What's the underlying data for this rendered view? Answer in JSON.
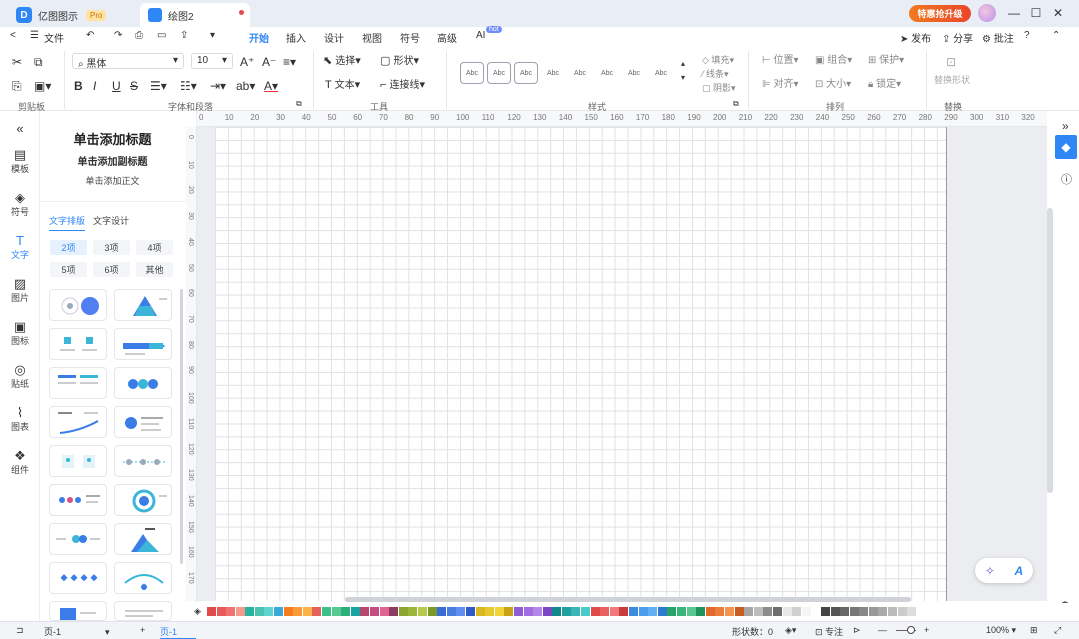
{
  "titlebar": {
    "app_tab": "亿图图示",
    "pro_badge": "Pro",
    "doc_tab": "绘图2",
    "upgrade": "特惠抢升级",
    "win_min": "—",
    "win_max": "☐",
    "win_close": "✕"
  },
  "menubar": {
    "back": "<",
    "file": "文件",
    "undo": "↶",
    "redo": "↷",
    "items": [
      "开始",
      "插入",
      "设计",
      "视图",
      "符号",
      "高级",
      "AI"
    ],
    "hot": "hot",
    "publish": "发布",
    "share": "分享",
    "comment": "批注",
    "help": "?"
  },
  "ribbon": {
    "font_family": "黑体",
    "font_size": "10",
    "select": "选择",
    "shape": "形状",
    "text": "文本",
    "connector": "连接线",
    "fill": "填充",
    "line": "线条",
    "shadow": "阴影",
    "position": "位置",
    "group": "组合",
    "protect": "保护",
    "align": "对齐",
    "size": "大小",
    "lock": "锁定",
    "replace": "替换形状",
    "style_label": "Abc",
    "groups": {
      "clipboard": "剪贴板",
      "font": "字体和段落",
      "tools": "工具",
      "styles": "样式",
      "arrange": "排列",
      "replace": "替换"
    }
  },
  "leftbar": {
    "items": [
      {
        "icon": "«",
        "label": ""
      },
      {
        "icon": "▤",
        "label": "模板"
      },
      {
        "icon": "◈",
        "label": "符号"
      },
      {
        "icon": "T",
        "label": "文字"
      },
      {
        "icon": "▨",
        "label": "图片"
      },
      {
        "icon": "▣",
        "label": "图标"
      },
      {
        "icon": "◎",
        "label": "贴纸"
      },
      {
        "icon": "⌇",
        "label": "图表"
      },
      {
        "icon": "❖",
        "label": "组件"
      }
    ]
  },
  "panel": {
    "title": "单击添加标题",
    "subtitle": "单击添加副标题",
    "body": "单击添加正文",
    "tabs": [
      "文字排版",
      "文字设计"
    ],
    "chips": [
      "2项",
      "3项",
      "4项",
      "5项",
      "6项",
      "其他"
    ]
  },
  "ruler": {
    "top": [
      "0",
      "10",
      "20",
      "30",
      "40",
      "50",
      "60",
      "70",
      "80",
      "90",
      "100",
      "110",
      "120",
      "130",
      "140",
      "150",
      "160",
      "170",
      "180",
      "190",
      "200",
      "210",
      "220",
      "230",
      "240",
      "250",
      "260",
      "270",
      "280",
      "290",
      "300",
      "310",
      "320"
    ],
    "left": [
      "0",
      "10",
      "20",
      "30",
      "40",
      "50",
      "60",
      "70",
      "80",
      "90",
      "100",
      "110",
      "120",
      "130",
      "140",
      "150",
      "160",
      "170"
    ]
  },
  "colors": [
    "#e24a4a",
    "#e85a5a",
    "#f07272",
    "#f39a8a",
    "#26b49f",
    "#4bc3b2",
    "#5fd3d0",
    "#3aa8d8",
    "#f57c1f",
    "#f89a3a",
    "#fbb24a",
    "#e2625a",
    "#3cbf8a",
    "#56c98f",
    "#2bb07c",
    "#19a3a3",
    "#b6466e",
    "#c24d7e",
    "#e06491",
    "#8e3b62",
    "#8aa531",
    "#9ab53c",
    "#b5c94a",
    "#7c9a2a",
    "#3b6bd6",
    "#4a7de0",
    "#5f8ff0",
    "#2f5cc4",
    "#d9b823",
    "#e6c830",
    "#f0d43a",
    "#c9a218",
    "#8e5cd6",
    "#a06ee2",
    "#b488ea",
    "#7a48c4",
    "#0f8a8a",
    "#22a0a0",
    "#3bb5b5",
    "#4acaca",
    "#e04a4a",
    "#ea6060",
    "#f07a7a",
    "#c93a3a",
    "#3c8bdc",
    "#4a9cec",
    "#62aef2",
    "#2c7bcc",
    "#2aa36a",
    "#3ab57a",
    "#58c690",
    "#1f935a",
    "#e06a2a",
    "#ea7c3c",
    "#f29450",
    "#c95c20",
    "#a6a6a6",
    "#bdbdbd",
    "#8c8c8c",
    "#6e6e6e",
    "#e8e8e8",
    "#d0d0d0",
    "#f5f5f5",
    "#ffffff",
    "#444444",
    "#555555",
    "#666666",
    "#777777",
    "#888888",
    "#999999",
    "#aaaaaa",
    "#bbbbbb",
    "#cccccc",
    "#dddddd"
  ],
  "statusbar": {
    "page_select": "页-1",
    "page_tab": "页-1",
    "shape_count": "形状数：0",
    "focus": "专注",
    "zoom": "100%"
  }
}
